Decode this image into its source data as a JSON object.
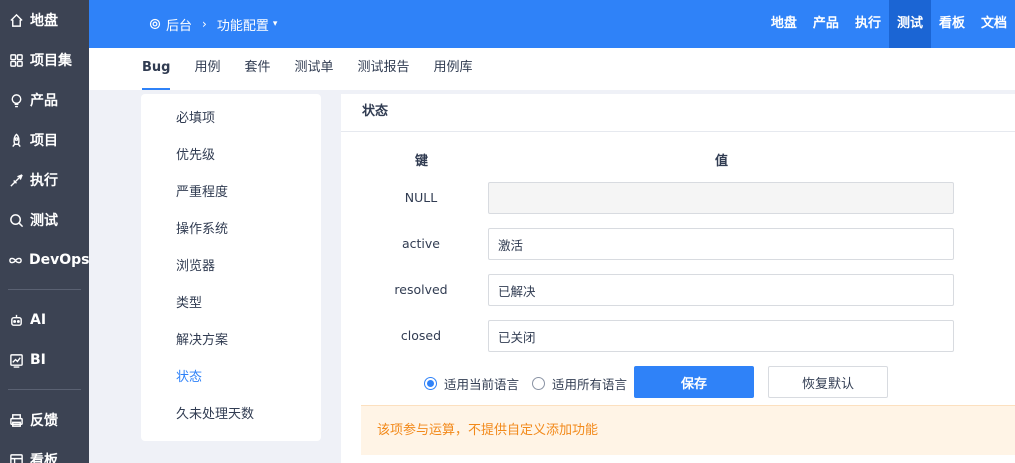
{
  "leftnav": {
    "group1": [
      {
        "label": "地盘",
        "icon": "home-icon"
      },
      {
        "label": "项目集",
        "icon": "grid-icon"
      },
      {
        "label": "产品",
        "icon": "lightbulb-icon"
      },
      {
        "label": "项目",
        "icon": "rocket-icon"
      },
      {
        "label": "执行",
        "icon": "send-icon"
      },
      {
        "label": "测试",
        "icon": "search-icon"
      },
      {
        "label": "DevOps",
        "icon": "infinity-icon"
      }
    ],
    "group2": [
      {
        "label": "AI",
        "icon": "robot-icon"
      },
      {
        "label": "BI",
        "icon": "chart-icon"
      }
    ],
    "group3": [
      {
        "label": "反馈",
        "icon": "printer-icon"
      },
      {
        "label": "看板",
        "icon": "board-icon"
      }
    ]
  },
  "header": {
    "breadcrumb_root": "后台",
    "breadcrumb_sep": "›",
    "breadcrumb_current": "功能配置",
    "caret": "▾",
    "topnav": [
      "地盘",
      "产品",
      "执行",
      "测试",
      "看板",
      "文档"
    ],
    "topnav_active": "测试",
    "colors": {
      "header_bg": "#2f82f8",
      "active_tab": "#1b65d4",
      "sidebar_bg": "#3c4353"
    }
  },
  "subnav": {
    "items": [
      "Bug",
      "用例",
      "套件",
      "测试单",
      "测试报告",
      "用例库"
    ],
    "active": "Bug"
  },
  "sidemenu": {
    "items": [
      "必填项",
      "优先级",
      "严重程度",
      "操作系统",
      "浏览器",
      "类型",
      "解决方案",
      "状态",
      "久未处理天数"
    ],
    "active": "状态"
  },
  "main": {
    "title": "状态",
    "col_key": "键",
    "col_value": "值",
    "rows": [
      {
        "key": "NULL",
        "value": "",
        "disabled": true
      },
      {
        "key": "active",
        "value": "激活",
        "disabled": false
      },
      {
        "key": "resolved",
        "value": "已解决",
        "disabled": false
      },
      {
        "key": "closed",
        "value": "已关闭",
        "disabled": false
      }
    ],
    "radio_current": "适用当前语言",
    "radio_all": "适用所有语言",
    "save_label": "保存",
    "reset_label": "恢复默认",
    "notice": "该项参与运算，不提供自定义添加功能"
  }
}
